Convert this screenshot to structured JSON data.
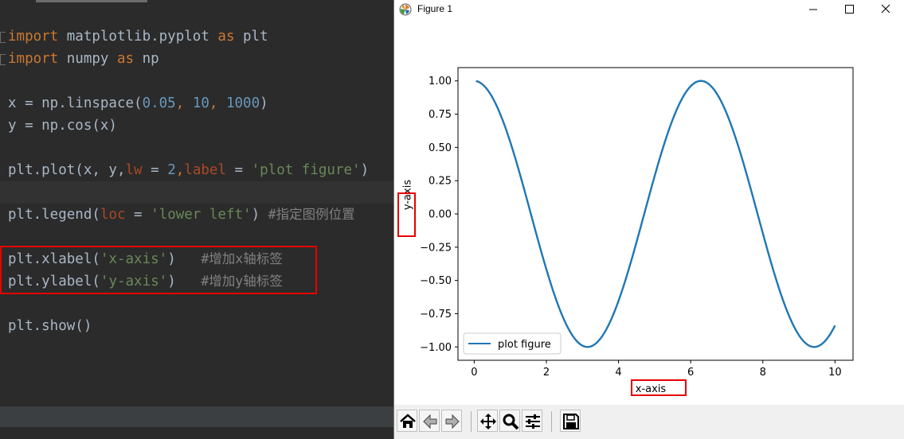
{
  "editor": {
    "lines": [
      {
        "kw1": "import",
        "mod": " matplotlib.pyplot ",
        "kw2": "as",
        "alias": " plt"
      },
      {
        "kw1": "import",
        "mod": " numpy ",
        "kw2": "as",
        "alias": " np"
      },
      {
        "blank": true
      },
      {
        "pre": "x = np.linspace(",
        "n1": "0.05",
        "c1": ", ",
        "n2": "10",
        "c2": ", ",
        "n3": "1000",
        "post": ")"
      },
      {
        "text": "y = np.cos(x)"
      },
      {
        "blank": true
      },
      {
        "pre": "plt.plot(x, y,",
        "kw1": "lw",
        "mid1": " = ",
        "n1": "2",
        "c1": ",",
        "kw2": "label",
        "mid2": " = ",
        "s": "'plot figure'",
        "post": ")"
      },
      {
        "blank": true
      },
      {
        "pre": "plt.legend(",
        "kw1": "loc",
        "mid1": " = ",
        "s": "'lower left'",
        "post": ") ",
        "cmt": "#指定图例位置"
      },
      {
        "blank": true
      },
      {
        "pre": "plt.xlabel(",
        "s": "'x-axis'",
        "post": ")   ",
        "cmt": "#增加x轴标签"
      },
      {
        "pre": "plt.ylabel(",
        "s": "'y-axis'",
        "post": ")   ",
        "cmt": "#增加y轴标签"
      },
      {
        "blank": true
      },
      {
        "text": "plt.show()"
      }
    ]
  },
  "window": {
    "title": "Figure 1",
    "controls": {
      "minimize": "minimize-icon",
      "maximize": "maximize-icon",
      "close": "close-icon"
    }
  },
  "chart_data": {
    "type": "line",
    "function": "cos(x)",
    "x_range": [
      0.05,
      10
    ],
    "x": [
      0.05,
      0.5,
      1.0,
      1.5,
      2.0,
      2.5,
      3.0,
      3.14,
      3.5,
      4.0,
      4.5,
      5.0,
      5.5,
      6.0,
      6.28,
      6.5,
      7.0,
      7.5,
      8.0,
      8.5,
      9.0,
      9.42,
      9.7,
      10.0
    ],
    "y": [
      0.999,
      0.878,
      0.54,
      0.071,
      -0.416,
      -0.801,
      -0.99,
      -1.0,
      -0.936,
      -0.654,
      -0.211,
      0.284,
      0.709,
      0.96,
      1.0,
      0.977,
      0.754,
      0.347,
      -0.146,
      -0.602,
      -0.911,
      -1.0,
      -0.962,
      -0.839
    ],
    "series": [
      {
        "name": "plot figure",
        "color": "#1f77b4"
      }
    ],
    "xlabel": "x-axis",
    "ylabel": "y-axis",
    "xlim": [
      -0.45,
      10.5
    ],
    "ylim": [
      -1.1,
      1.1
    ],
    "xticks": [
      0,
      2,
      4,
      6,
      8,
      10
    ],
    "xtick_labels": [
      "0",
      "2",
      "4",
      "6",
      "8",
      "10"
    ],
    "yticks": [
      1.0,
      0.75,
      0.5,
      0.25,
      0.0,
      -0.25,
      -0.5,
      -0.75,
      -1.0
    ],
    "ytick_labels": [
      "1.00",
      "0.75",
      "0.50",
      "0.25",
      "0.00",
      "−0.25",
      "−0.50",
      "−0.75",
      "−1.00"
    ],
    "legend": {
      "placement": "lower-left",
      "label": "plot figure"
    },
    "grid": false
  },
  "toolbar": {
    "buttons": [
      "home-icon",
      "back-icon",
      "forward-icon",
      "pan-icon",
      "zoom-icon",
      "configure-subplots-icon",
      "save-icon"
    ]
  },
  "colors": {
    "highlight": "#e60000",
    "line": "#1f77b4",
    "editor_bg": "#2b2b2b"
  }
}
